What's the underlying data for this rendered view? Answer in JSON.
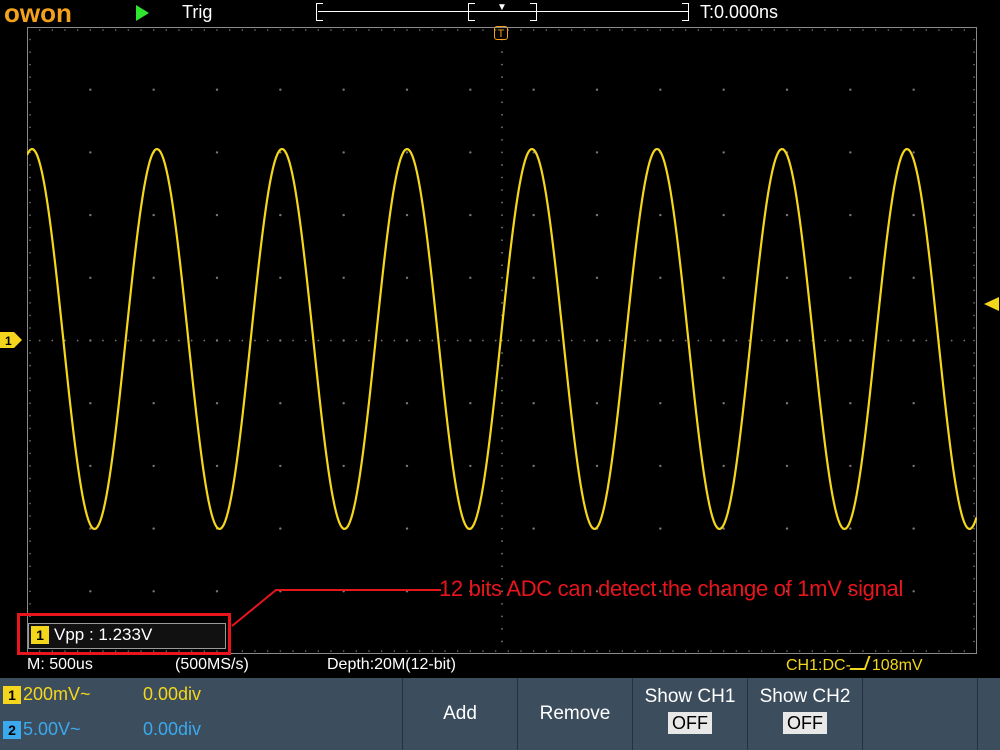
{
  "top": {
    "logo": "owon",
    "trig_status": "Trig",
    "time_pos": "T:0.000ns"
  },
  "markers": {
    "trig_glyph": "T",
    "ch1_glyph": "1"
  },
  "measurement": {
    "channel": "1",
    "text": "Vpp : 1.233V"
  },
  "annotation": "12 bits ADC can detect the change of 1mV signal",
  "status": {
    "timebase": "M: 500us",
    "sample_rate": "(500MS/s)",
    "depth": "Depth:20M(12-bit)",
    "trigger_prefix": "CH1:DC-",
    "trigger_level": "108mV"
  },
  "channels": [
    {
      "num": "1",
      "vdiv": "200mV~",
      "offset": "0.00div",
      "color": "#f4d71c"
    },
    {
      "num": "2",
      "vdiv": "5.00V~",
      "offset": "0.00div",
      "color": "#3aa9ee"
    }
  ],
  "menu": {
    "add": "Add",
    "remove": "Remove",
    "show_ch1": "Show CH1",
    "show_ch1_state": "OFF",
    "show_ch2": "Show CH2",
    "show_ch2_state": "OFF"
  },
  "colors": {
    "trace": "#f4d71c",
    "logo": "#f4a21c",
    "annotation": "#e8161c",
    "menu_bg": "#3c4d5e"
  }
}
